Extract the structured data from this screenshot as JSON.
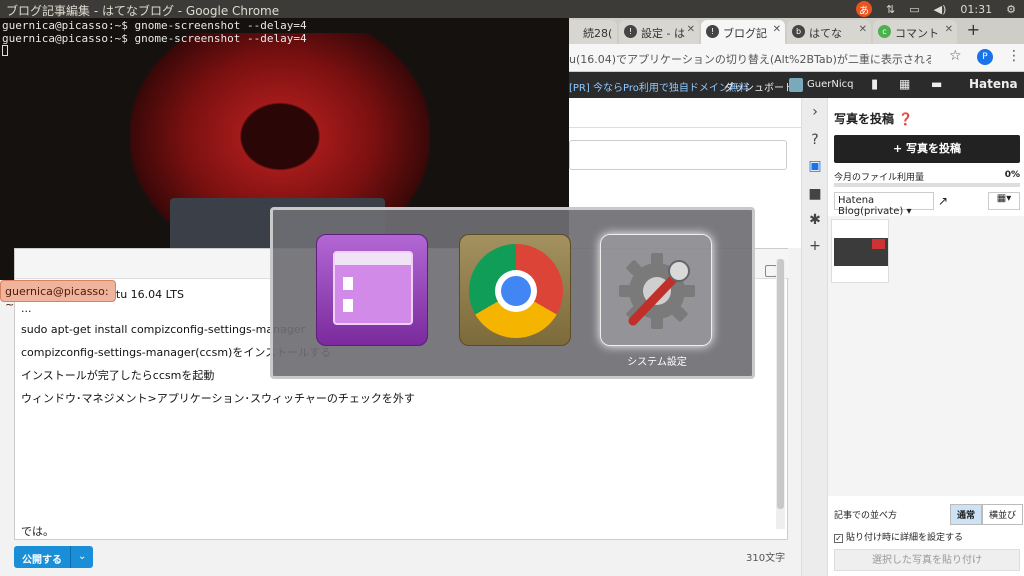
{
  "window_title": "ブログ記事編集 - はてなブログ - Google Chrome",
  "tray": {
    "ime": "あ",
    "clock": "01:31",
    "icons": [
      "ime-icon",
      "network-icon",
      "battery-icon",
      "volume-icon",
      "power-icon"
    ]
  },
  "terminal": {
    "lines": [
      "guernica@picasso:~$ gnome-screenshot --delay=4",
      "guernica@picasso:~$ gnome-screenshot --delay=4"
    ],
    "label": "guernica@picasso: ~"
  },
  "tabs": [
    {
      "label": "続28(",
      "active": false
    },
    {
      "label": "設定 - は",
      "active": false
    },
    {
      "label": "ブログ記",
      "active": true
    },
    {
      "label": "はてな",
      "active": false
    },
    {
      "label": "コマント",
      "active": false
    }
  ],
  "addressbar": {
    "url": "u(16.04)でアプリケーションの切り替え(Alt%2BTab)が二重に表示される時の対...",
    "profile": "P"
  },
  "hatena_bar": {
    "promo": "[PR] 今ならPro利用で独自ドメイン無料",
    "dashboard": "ダッシュボード",
    "user": "GuerNicq",
    "logo": "Hatena"
  },
  "editor": {
    "lines": [
      "動作環境：ubuntu 16.04 LTS",
      "···",
      "sudo apt-get install compizconfig-settings-manager",
      "compizconfig-settings-manager(ccsm)をインストールする",
      "インストールが完了したらccsmを起動",
      "ウィンドウ･マネジメント>アプリケーション･スウィッチャーのチェックを外す"
    ],
    "last_line": "では。",
    "publish_label": "公開する",
    "char_count": "310文字"
  },
  "photo_panel": {
    "title": "写真を投稿",
    "upload_label": "+ 写真を投稿",
    "usage_label": "今月のファイル利用量",
    "usage_pct": "0%",
    "album": "Hatena Blog(private)",
    "sort_label": "記事での並べ方",
    "sort_options": [
      "通常",
      "横並び"
    ],
    "detail_label": "貼り付け時に詳細を設定する",
    "paste_label": "選択した写真を貼り付け"
  },
  "switcher": {
    "apps": [
      {
        "name": "files",
        "label": ""
      },
      {
        "name": "chrome",
        "label": ""
      },
      {
        "name": "system-settings",
        "label": "システム設定"
      }
    ]
  }
}
